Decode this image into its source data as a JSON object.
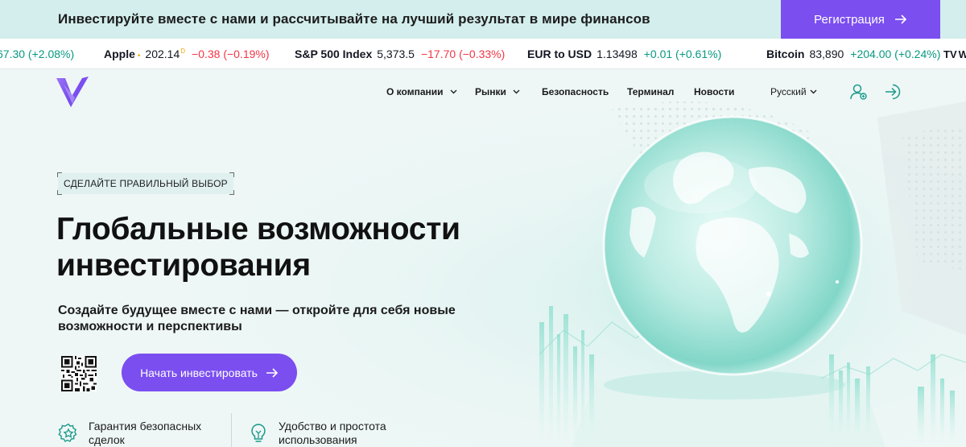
{
  "promo": {
    "text": "Инвестируйте вместе с нами и рассчитывайте на лучший результат в мире финансов",
    "register_label": "Регистрация"
  },
  "ticker": [
    {
      "name": "",
      "price": "",
      "change": "67.30 (+2.08%)",
      "dir": "up"
    },
    {
      "name": "Apple",
      "price": "202.14",
      "suffix": "D",
      "change": "−0.38 (−0.19%)",
      "dir": "down"
    },
    {
      "name": "S&P 500 Index",
      "price": "5,373.5",
      "change": "−17.70 (−0.33%)",
      "dir": "down"
    },
    {
      "name": "EUR to USD",
      "price": "1.13498",
      "change": "+0.01 (+0.61%)",
      "dir": "up"
    },
    {
      "name": "Bitcoin",
      "price": "83,890",
      "change": "+204.00 (+0.24%)",
      "dir": "up"
    }
  ],
  "ticker_brand": "TV",
  "ticker_tail": "W",
  "nav": {
    "about": "О компании",
    "markets": "Рынки",
    "security": "Безопасность",
    "terminal": "Терминал",
    "news": "Новости",
    "language": "Русский"
  },
  "hero": {
    "tag": "СДЕЛАЙТЕ ПРАВИЛЬНЫЙ ВЫБОР",
    "title_line1": "Глобальные возможности",
    "title_line2": "инвестирования",
    "subtitle_line1": "Создайте будущее вместе с нами — откройте для себя новые",
    "subtitle_line2": "возможности и перспективы",
    "cta_label": "Начать инвестировать"
  },
  "features": [
    {
      "line1": "Гарантия безопасных",
      "line2": "сделок",
      "icon": "shield-star-icon"
    },
    {
      "line1": "Удобство и простота",
      "line2": "использования",
      "icon": "lightbulb-icon"
    }
  ],
  "colors": {
    "accent": "#7b4ef0",
    "promo_bg": "#d3eeec",
    "page_bg": "#eef7f6",
    "up": "#089981",
    "down": "#f23645",
    "feature_icon": "#1a9a8a"
  }
}
